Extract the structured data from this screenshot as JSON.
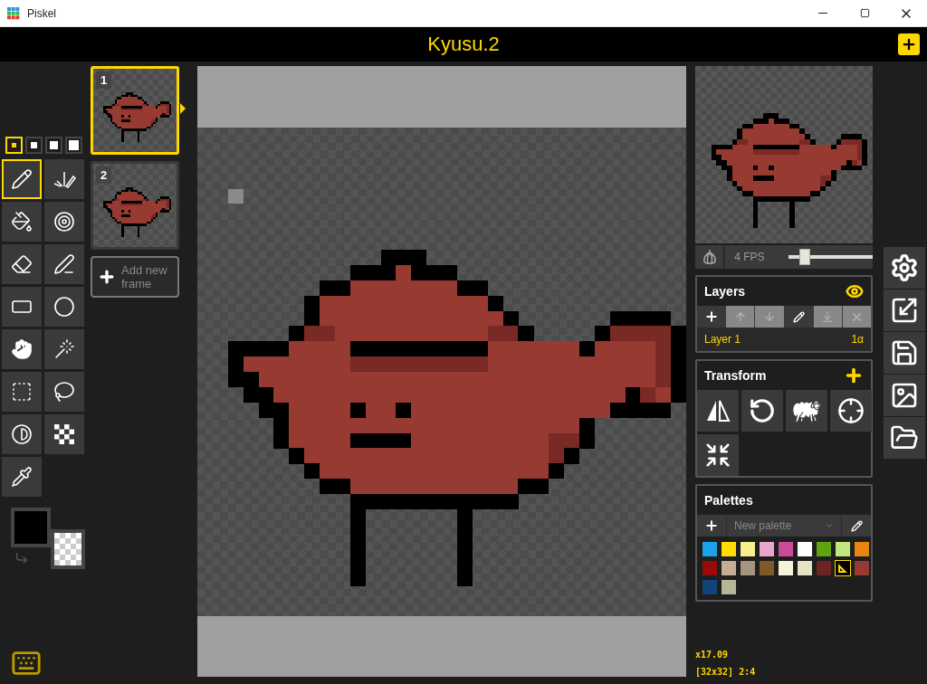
{
  "window": {
    "title": "Piskel"
  },
  "header": {
    "title": "Kyusu.2"
  },
  "pen_sizes": [
    {
      "selected": true
    },
    {
      "selected": false
    },
    {
      "selected": false
    },
    {
      "selected": false
    }
  ],
  "tools": [
    {
      "kind": "pen",
      "selected": true
    },
    {
      "kind": "mirror_pen",
      "selected": false
    },
    {
      "kind": "bucket",
      "selected": false
    },
    {
      "kind": "same_color_bucket",
      "selected": false
    },
    {
      "kind": "eraser",
      "selected": false
    },
    {
      "kind": "stroke",
      "selected": false
    },
    {
      "kind": "rectangle",
      "selected": false
    },
    {
      "kind": "ellipse",
      "selected": false
    },
    {
      "kind": "pan",
      "selected": false
    },
    {
      "kind": "magic_wand",
      "selected": false
    },
    {
      "kind": "rect_select",
      "selected": false
    },
    {
      "kind": "lasso",
      "selected": false
    },
    {
      "kind": "lighten",
      "selected": false
    },
    {
      "kind": "dither",
      "selected": false
    },
    {
      "kind": "picker",
      "selected": false
    }
  ],
  "frames": [
    {
      "number": "1",
      "selected": true
    },
    {
      "number": "2",
      "selected": false
    }
  ],
  "add_frame": {
    "label": "Add new frame"
  },
  "preview": {
    "fps": "4 FPS",
    "level": 0.2
  },
  "layers": {
    "title": "Layers",
    "buttons": [
      {
        "kind": "add",
        "disabled": false
      },
      {
        "kind": "up",
        "disabled": true
      },
      {
        "kind": "down",
        "disabled": true
      },
      {
        "kind": "edit",
        "disabled": false
      },
      {
        "kind": "merge",
        "disabled": true
      },
      {
        "kind": "delete",
        "disabled": true
      }
    ],
    "items": [
      {
        "name": "Layer 1",
        "opacity": "1α",
        "selected": true
      }
    ]
  },
  "transform": {
    "title": "Transform",
    "tools": [
      {
        "kind": "flip"
      },
      {
        "kind": "rotate"
      },
      {
        "kind": "clone"
      },
      {
        "kind": "center"
      },
      {
        "kind": "crop"
      }
    ]
  },
  "palettes": {
    "title": "Palettes",
    "selector": "New palette",
    "swatches": [
      {
        "color": "#1da1e9",
        "selected": false
      },
      {
        "color": "#ffdd00",
        "selected": false
      },
      {
        "color": "#f7ee8c",
        "selected": false
      },
      {
        "color": "#eaa6ca",
        "selected": false
      },
      {
        "color": "#cc4a9c",
        "selected": false
      },
      {
        "color": "#ffffff",
        "selected": false
      },
      {
        "color": "#5fa30e",
        "selected": false
      },
      {
        "color": "#bfe77d",
        "selected": false
      },
      {
        "color": "#e8850e",
        "selected": false
      },
      {
        "color": "#9a0a0a",
        "selected": false
      },
      {
        "color": "#c4ad94",
        "selected": false
      },
      {
        "color": "#a39580",
        "selected": false
      },
      {
        "color": "#7f5a24",
        "selected": false
      },
      {
        "color": "#f7f3d8",
        "selected": false
      },
      {
        "color": "#e5e2c6",
        "selected": false
      },
      {
        "color": "#6a2524",
        "selected": false
      },
      {
        "color": "#000000",
        "selected": true
      },
      {
        "color": "#963a32",
        "selected": false
      },
      {
        "color": "#11447a",
        "selected": false
      },
      {
        "color": "#b7b597",
        "selected": false
      }
    ]
  },
  "status": {
    "zoom": "x17.09",
    "info": "[32x32] 2:4"
  },
  "side_buttons": [
    {
      "kind": "settings"
    },
    {
      "kind": "resize"
    },
    {
      "kind": "save"
    },
    {
      "kind": "export"
    },
    {
      "kind": "open"
    }
  ]
}
